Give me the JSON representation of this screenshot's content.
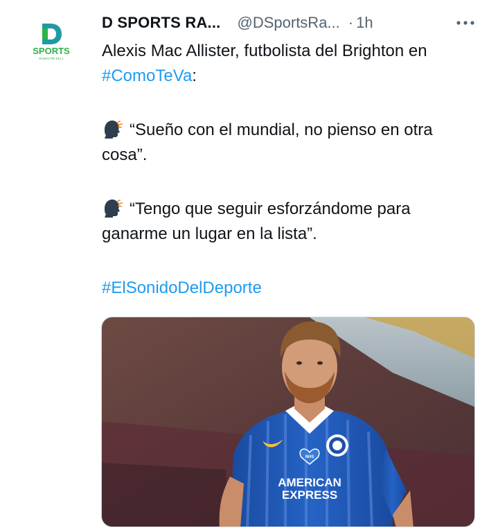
{
  "account": {
    "display_name": "D SPORTS RA...",
    "handle": "@DSportsRa...",
    "separator": "·",
    "time": "1h",
    "avatar_brand": "SPORTS",
    "avatar_sub": "RADIO FM 103.1",
    "avatar_letter": "D"
  },
  "tweet": {
    "intro_text": "Alexis Mac Allister, futbolista del Brighton en ",
    "intro_hashtag": "#ComoTeVa",
    "intro_suffix": ":",
    "quote1": "“Sueño con el mundial, no pienso en otra cosa”.",
    "quote2": "“Tengo que seguir esforzándome para ganarme un lugar en la lista”.",
    "hashtag2": "#ElSonidoDelDeporte",
    "quote_icon": "speaking-head-icon"
  },
  "media": {
    "jersey_sponsor_line1": "AMERICAN",
    "jersey_sponsor_line2": "EXPRESS",
    "jersey_badge": "NHS"
  },
  "colors": {
    "link": "#1d9bf0",
    "secondary_text": "#536471",
    "primary_text": "#0f1419",
    "brand_green": "#2db34a",
    "brand_teal": "#1f9aa5",
    "jersey_blue": "#1d4fa8"
  },
  "icons": {
    "more": "more-horizontal-icon"
  }
}
